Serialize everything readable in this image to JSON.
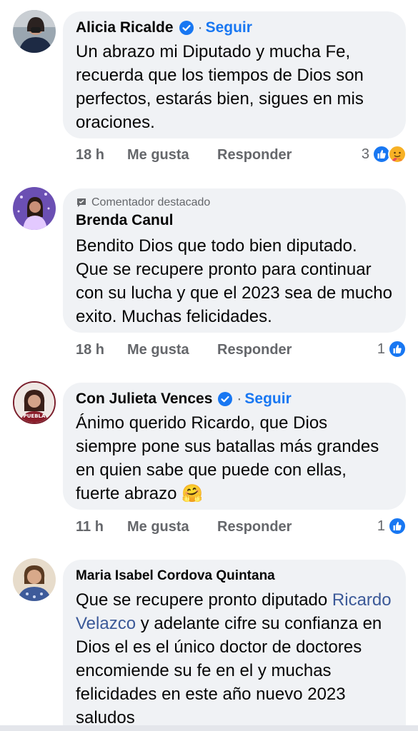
{
  "comments": [
    {
      "author": "Alicia Ricalde",
      "verified": true,
      "follow_label": "Seguir",
      "separator": "·",
      "text": "Un abrazo mi Diputado y mucha Fe, recuerda que los tiempos de Dios son perfectos, estarás bien, sigues en mis oraciones.",
      "time": "18 h",
      "like_label": "Me gusta",
      "reply_label": "Responder",
      "reaction_count": "3",
      "reactions": [
        "like-icon",
        "care-icon"
      ]
    },
    {
      "badge": "Comentador destacado",
      "author": "Brenda Canul",
      "text": "Bendito Dios que todo bien diputado. Que se recupere pronto para continuar con su lucha y que el 2023 sea de mucho exito. Muchas felicidades.",
      "time": "18 h",
      "like_label": "Me gusta",
      "reply_label": "Responder",
      "reaction_count": "1",
      "reactions": [
        "like-icon"
      ]
    },
    {
      "author": "Con Julieta Vences",
      "verified": true,
      "follow_label": "Seguir",
      "separator": "·",
      "avatar_text": "PUEBLA",
      "text": "Ánimo querido Ricardo, que Dios siempre pone sus batallas más grandes en quien sabe que puede con ellas, fuerte abrazo",
      "emoji": "🤗",
      "time": "11 h",
      "like_label": "Me gusta",
      "reply_label": "Responder",
      "reaction_count": "1",
      "reactions": [
        "like-icon"
      ]
    },
    {
      "author": "Maria Isabel Cordova Quintana",
      "text_before": "Que se recupere pronto diputado",
      "mention": "Ricardo Velazco",
      "text_after": "y adelante cifre su confianza en Dios el es el único doctor de doctores encomiende su fe en el y muchas felicidades en este año nuevo 2023 saludos"
    }
  ],
  "colors": {
    "bubble": "#f0f2f5",
    "link": "#1877f2",
    "meta": "#65676b"
  }
}
